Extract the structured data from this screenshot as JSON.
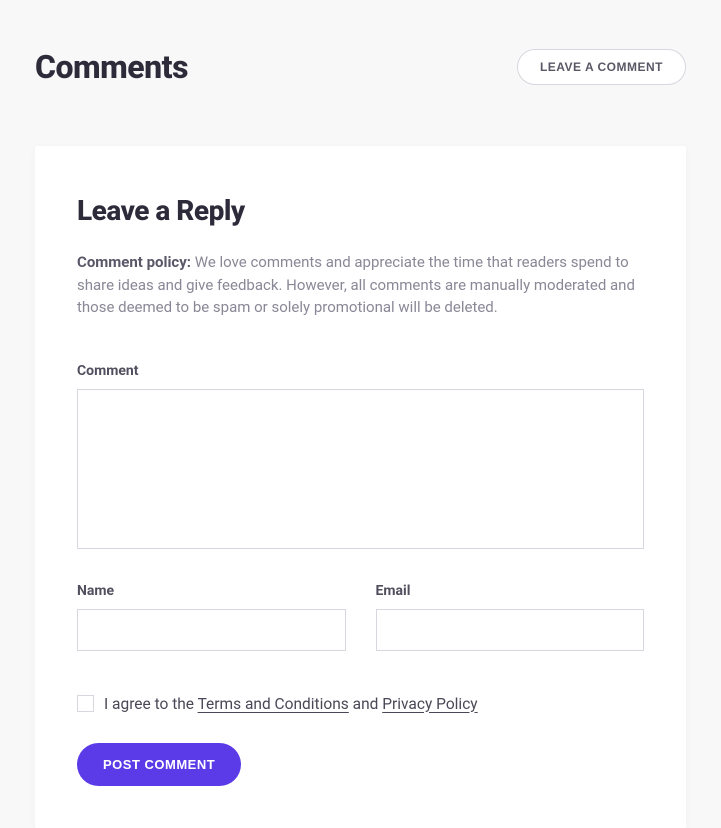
{
  "header": {
    "title": "Comments",
    "leave_button": "LEAVE A COMMENT"
  },
  "form": {
    "title": "Leave a Reply",
    "policy_label": "Comment policy:",
    "policy_text": " We love comments and appreciate the time that readers spend to share ideas and give feedback. However, all comments are manually moderated and those deemed to be spam or solely promotional will be deleted.",
    "comment_label": "Comment",
    "comment_value": "",
    "name_label": "Name",
    "name_value": "",
    "email_label": "Email",
    "email_value": "",
    "agree_prefix": "I agree to the ",
    "terms_link": "Terms and Conditions",
    "agree_middle": " and ",
    "privacy_link": "Privacy Policy",
    "submit_label": "POST COMMENT"
  }
}
